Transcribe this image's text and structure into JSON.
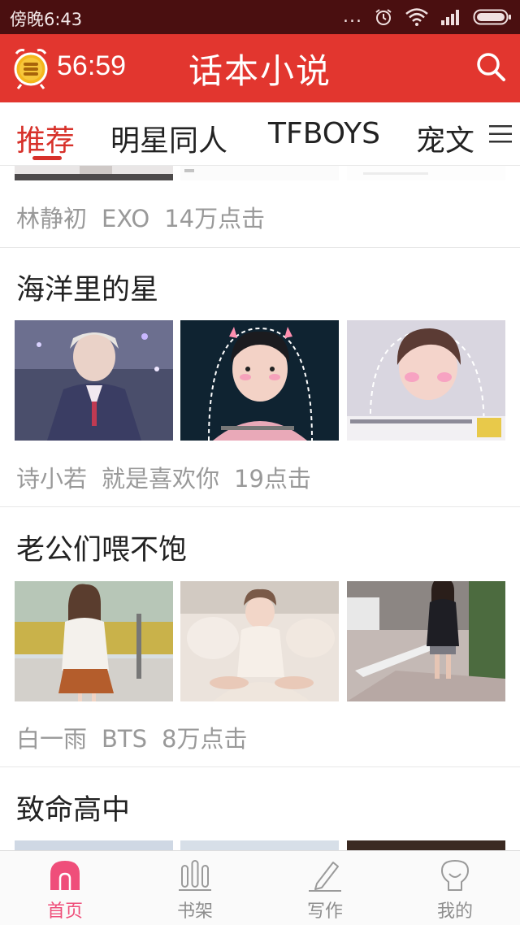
{
  "status_bar": {
    "time": "傍晚6:43",
    "dots": "..."
  },
  "header": {
    "timer": "56:59",
    "title": "话本小说",
    "accent_color": "#e2362f"
  },
  "tabs": [
    {
      "label": "推荐",
      "active": true
    },
    {
      "label": "明星同人",
      "active": false
    },
    {
      "label": "TFBOYS",
      "active": false
    },
    {
      "label": "宠文",
      "active": false
    }
  ],
  "feed": {
    "partial_card": {
      "author": "林静初",
      "category": "EXO",
      "clicks": "14万点击"
    },
    "cards": [
      {
        "title": "海洋里的星",
        "author": "诗小若",
        "category": "就是喜欢你",
        "clicks": "19点击"
      },
      {
        "title": "老公们喂不饱",
        "author": "白一雨",
        "category": "BTS",
        "clicks": "8万点击"
      },
      {
        "title": "致命高中"
      }
    ]
  },
  "bottom_nav": [
    {
      "label": "首页",
      "icon": "home-icon",
      "active": true
    },
    {
      "label": "书架",
      "icon": "bookshelf-icon",
      "active": false
    },
    {
      "label": "写作",
      "icon": "pen-icon",
      "active": false
    },
    {
      "label": "我的",
      "icon": "profile-icon",
      "active": false
    }
  ]
}
